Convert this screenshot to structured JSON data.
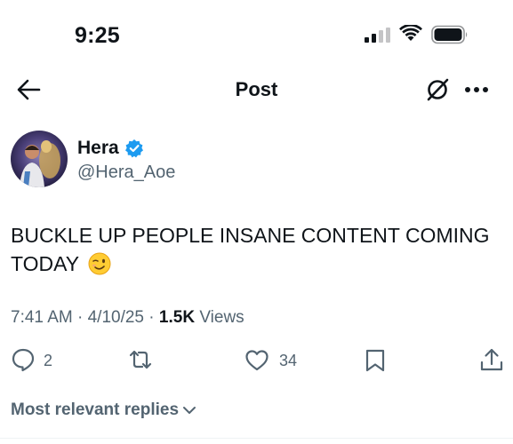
{
  "status_bar": {
    "time": "9:25",
    "icons": [
      "cellular-signal-icon",
      "wifi-icon",
      "battery-icon"
    ]
  },
  "header": {
    "title": "Post",
    "back_icon": "arrow-left-icon",
    "grok_icon": "grok-icon",
    "more_icon": "more-dots-icon"
  },
  "author": {
    "display_name": "Hera",
    "handle": "@Hera_Aoe",
    "verified": true,
    "verified_color": "#1d9bf0"
  },
  "post": {
    "text": "BUCKLE UP PEOPLE INSANE CONTENT COMING TODAY",
    "emoji": "winking-face"
  },
  "meta": {
    "time": "7:41 AM",
    "separator": "·",
    "date": "4/10/25",
    "views_count": "1.5K",
    "views_label": "Views"
  },
  "actions": {
    "reply_count": "2",
    "like_count": "34"
  },
  "replies": {
    "sort_label": "Most relevant replies"
  },
  "colors": {
    "text_primary": "#0f1419",
    "text_secondary": "#536471",
    "accent": "#1d9bf0"
  }
}
